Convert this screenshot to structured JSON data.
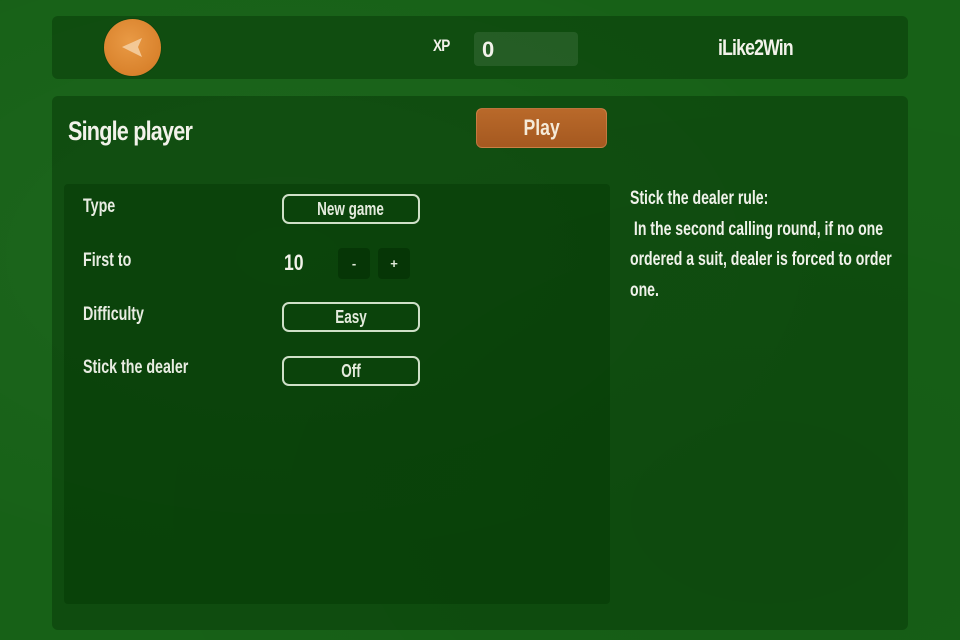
{
  "header": {
    "back_icon": "back-arrow-icon",
    "xp_label": "XP",
    "xp_value": "0",
    "username": "iLike2Win"
  },
  "main": {
    "title": "Single player",
    "play_label": "Play",
    "options": [
      {
        "label": "Type",
        "value": "New game"
      },
      {
        "label": "First to",
        "value": "10",
        "decrement": "-",
        "increment": "+"
      },
      {
        "label": "Difficulty",
        "value": "Easy"
      },
      {
        "label": "Stick the dealer",
        "value": "Off"
      }
    ],
    "rule": {
      "title": "Stick the dealer rule:",
      "body": " In the second calling round, if no one ordered a suit, dealer is forced to order one."
    }
  },
  "colors": {
    "background": "#176117",
    "accent_orange": "#d9822c",
    "play_button": "#a55920",
    "text": "#f2f2ea"
  }
}
